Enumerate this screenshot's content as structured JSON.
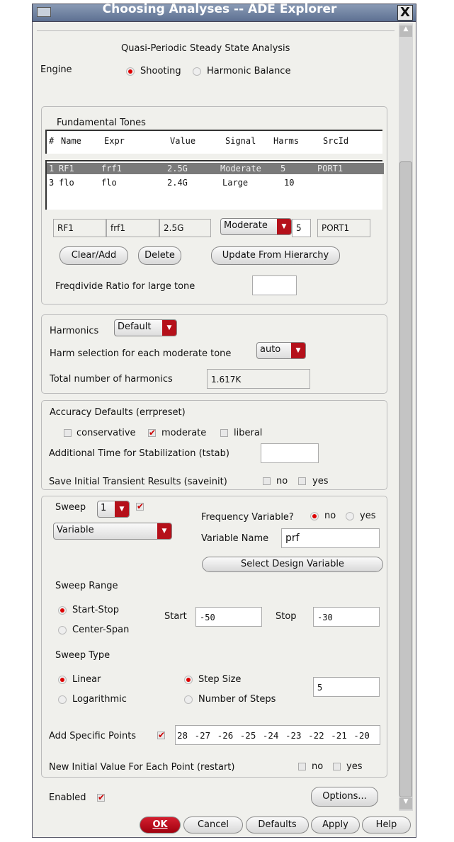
{
  "window": {
    "title": "Choosing Analyses -- ADE Explorer",
    "close": "X"
  },
  "header": {
    "analysis_title": "Quasi-Periodic Steady State Analysis",
    "engine_label": "Engine",
    "engine_options": [
      "Shooting",
      "Harmonic Balance"
    ],
    "engine_selected": "Shooting"
  },
  "tones": {
    "label": "Fundamental Tones",
    "columns": [
      "#",
      "Name",
      "Expr",
      "Value",
      "Signal",
      "Harms",
      "SrcId"
    ],
    "rows": [
      {
        "num": "1",
        "name": "RF1",
        "expr": "frf1",
        "value": "2.5G",
        "signal": "Moderate",
        "harms": "5",
        "srcid": "PORT1",
        "selected": true
      },
      {
        "num": "3",
        "name": "flo",
        "expr": "flo",
        "value": "2.4G",
        "signal": "Large",
        "harms": "10",
        "srcid": "",
        "selected": false
      }
    ],
    "edit": {
      "name": "RF1",
      "expr": "frf1",
      "value": "2.5G",
      "signal": "Moderate",
      "harms": "5",
      "srcid": "PORT1"
    },
    "buttons": {
      "clear_add": "Clear/Add",
      "delete": "Delete",
      "update": "Update From Hierarchy"
    },
    "freqdivide_label": "Freqdivide Ratio for large tone",
    "freqdivide_value": ""
  },
  "harmonics": {
    "label": "Harmonics",
    "value": "Default",
    "harm_sel_label": "Harm selection for each moderate tone",
    "harm_sel_value": "auto",
    "total_label": "Total number of harmonics",
    "total_value": "1.617K"
  },
  "accuracy": {
    "label": "Accuracy Defaults (errpreset)",
    "options": [
      "conservative",
      "moderate",
      "liberal"
    ],
    "selected": "moderate",
    "tstab_label": "Additional Time for Stabilization (tstab)",
    "tstab_value": "",
    "saveinit_label": "Save Initial Transient Results (saveinit)",
    "no": "no",
    "yes": "yes"
  },
  "sweep": {
    "label": "Sweep",
    "count": "1",
    "enabled": true,
    "type": "Variable",
    "freq_var_label": "Frequency Variable?",
    "no": "no",
    "yes": "yes",
    "var_name_label": "Variable Name",
    "var_name": "prf",
    "select_btn": "Select Design Variable",
    "range_label": "Sweep Range",
    "start_stop": "Start-Stop",
    "center_span": "Center-Span",
    "start_label": "Start",
    "start": "-50",
    "stop_label": "Stop",
    "stop": "-30",
    "type_label": "Sweep Type",
    "linear": "Linear",
    "log": "Logarithmic",
    "step_size": "Step Size",
    "num_steps": "Number of Steps",
    "step_value": "5",
    "add_points_label": "Add Specific Points",
    "add_points": "28 -27 -26 -25 -24 -23 -22 -21 -20",
    "restart_label": "New Initial Value For Each Point (restart)"
  },
  "footer": {
    "enabled_label": "Enabled",
    "options": "Options...",
    "ok": "OK",
    "cancel": "Cancel",
    "defaults": "Defaults",
    "apply": "Apply",
    "help": "Help"
  }
}
